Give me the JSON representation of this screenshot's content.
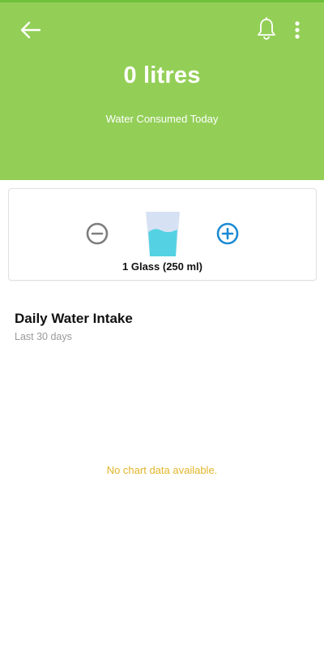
{
  "header": {
    "back_icon": "arrow-left-icon",
    "notification_icon": "bell-icon",
    "menu_icon": "more-vertical-icon",
    "amount_text": "0 litres",
    "amount_label": "Water Consumed Today",
    "background_color": "#93cf57"
  },
  "glass_card": {
    "decrease_icon": "minus-circle-icon",
    "increase_icon": "plus-circle-icon",
    "glass_icon": "water-glass-icon",
    "size_label": "1 Glass (250 ml)",
    "increase_color": "#1a8ad4",
    "decrease_color": "#7d7d7d"
  },
  "intake_section": {
    "title": "Daily Water Intake",
    "subtitle": "Last 30 days",
    "empty_message": "No chart data available.",
    "empty_message_color": "#e2b52a"
  }
}
